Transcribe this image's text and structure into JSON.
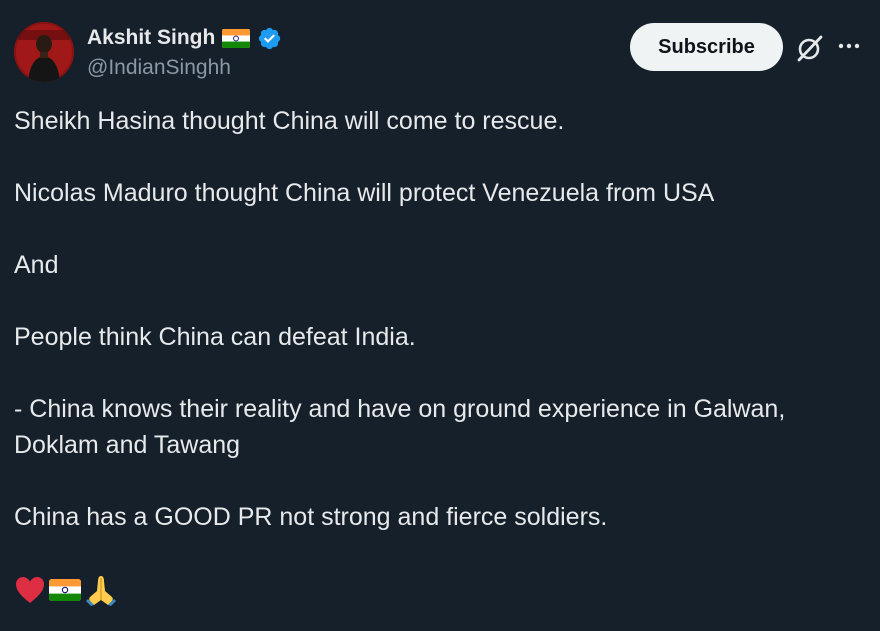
{
  "author": {
    "display_name": "Akshit Singh",
    "handle": "@IndianSinghh",
    "verified": true,
    "name_badge": "india-flag-emoji"
  },
  "actions": {
    "subscribe_label": "Subscribe",
    "grok_icon": "grok-icon",
    "more_icon": "more-icon"
  },
  "tweet": {
    "paragraphs": [
      "Sheikh Hasina thought China will come to rescue.",
      "Nicolas Maduro thought China will protect Venezuela from USA",
      "And",
      "People think China can defeat India.",
      "- China knows their reality and have on ground experience in Galwan, Doklam and Tawang",
      "China has a GOOD PR not strong and fierce soldiers."
    ],
    "emojis": [
      "red-heart-emoji",
      "india-flag-emoji",
      "folded-hands-emoji"
    ]
  },
  "colors": {
    "background": "#15202b",
    "text_primary": "#e7e9ea",
    "text_secondary": "#8b98a5",
    "verified_blue": "#1d9bf0",
    "subscribe_bg": "#eff3f4"
  }
}
